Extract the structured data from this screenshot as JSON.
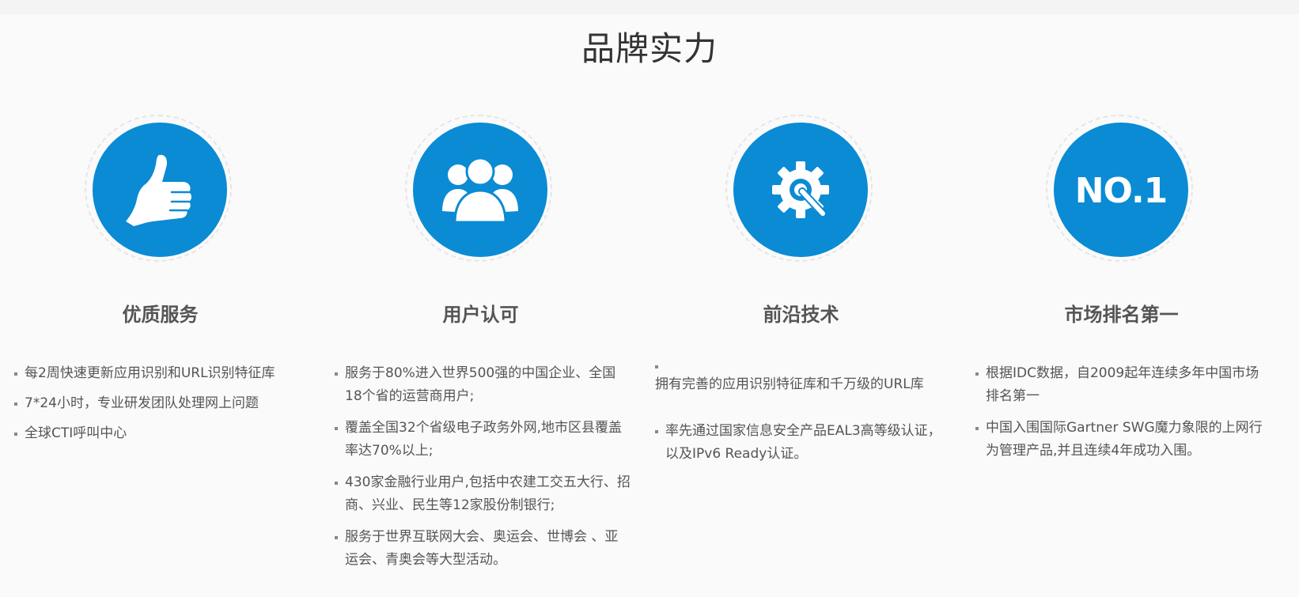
{
  "title": "品牌实力",
  "colors": {
    "accent": "#0a8bd4",
    "background": "#fafafa",
    "text": "#555555"
  },
  "columns": [
    {
      "icon": "thumbs-up-icon",
      "heading": "优质服务",
      "bullets": [
        "每2周快速更新应用识别和URL识别特征库",
        "7*24小时，专业研发团队处理网上问题",
        "全球CTI呼叫中心"
      ]
    },
    {
      "icon": "users-icon",
      "heading": "用户认可",
      "bullets": [
        "服务于80%进入世界500强的中国企业、全国18个省的运营商用户;",
        "覆盖全国32个省级电子政务外网,地市区县覆盖率达70%以上;",
        "430家金融行业用户,包括中农建工交五大行、招商、兴业、民生等12家股份制银行;",
        "服务于世界互联网大会、奥运会、世博会 、亚运会、青奥会等大型活动。"
      ]
    },
    {
      "icon": "gear-wrench-icon",
      "heading": "前沿技术",
      "bullets": [
        "拥有完善的应用识别特征库和千万级的URL库",
        "率先通过国家信息安全产品EAL3高等级认证，以及IPv6 Ready认证。"
      ]
    },
    {
      "icon": "no1-icon",
      "icon_text": "NO.1",
      "heading": "市场排名第一",
      "bullets": [
        "根据IDC数据，自2009起年连续多年中国市场排名第一",
        "中国入围国际Gartner SWG魔力象限的上网行为管理产品,并且连续4年成功入围。"
      ]
    }
  ]
}
